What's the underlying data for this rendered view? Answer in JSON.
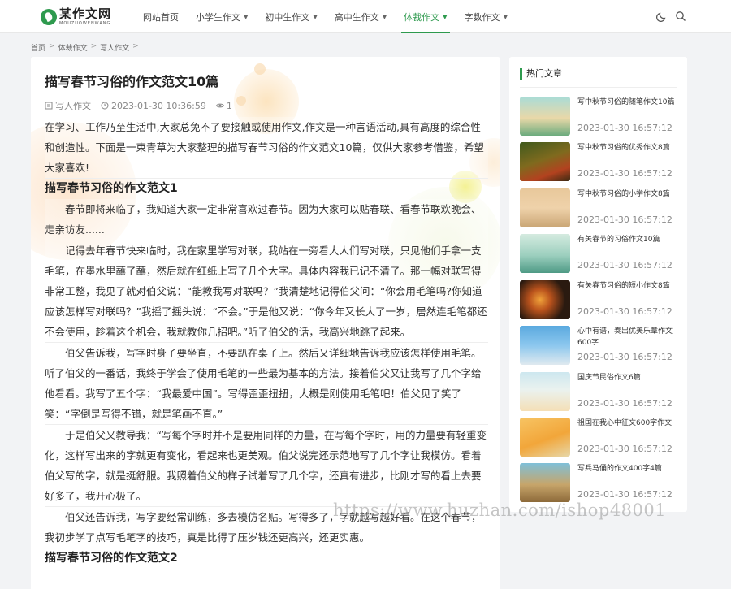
{
  "header": {
    "logo_cn": "某作文网",
    "logo_en": "MOUZUOWENWANG",
    "nav": [
      {
        "label": "网站首页",
        "caret": false
      },
      {
        "label": "小学生作文",
        "caret": true
      },
      {
        "label": "初中生作文",
        "caret": true
      },
      {
        "label": "高中生作文",
        "caret": true
      },
      {
        "label": "体裁作文",
        "caret": true,
        "active": true
      },
      {
        "label": "字数作文",
        "caret": true
      }
    ],
    "icons": [
      "moon-icon",
      "search-icon"
    ]
  },
  "breadcrumb": [
    "首页",
    "体裁作文",
    "写人作文"
  ],
  "article": {
    "title": "描写春节习俗的作文范文10篇",
    "category": "写人作文",
    "date": "2023-01-30 10:36:59",
    "views": "1",
    "intro": "在学习、工作乃至生活中,大家总免不了要接触或使用作文,作文是一种言语活动,具有高度的综合性和创造性。下面是一束青草为大家整理的描写春节习俗的作文范文10篇，仅供大家参考借鉴，希望大家喜欢!",
    "heading1": "描写春节习俗的作文范文1",
    "paragraphs": [
      "春节即将来临了，我知道大家一定非常喜欢过春节。因为大家可以贴春联、看春节联欢晚会、走亲访友......",
      "记得去年春节快来临时，我在家里学写对联，我站在一旁看大人们写对联，只见他们手拿一支毛笔，在墨水里蘸了蘸，然后就在红纸上写了几个大字。具体内容我已记不清了。那一幅对联写得非常工整，我见了就对伯父说：“能教我写对联吗？”我清楚地记得伯父问：“你会用毛笔吗?你知道应该怎样写对联吗？”我摇了摇头说：“不会。”于是他又说：“你今年又长大了一岁，居然连毛笔都还不会使用，趁着这个机会，我就教你几招吧。”听了伯父的话，我高兴地跳了起来。",
      "伯父告诉我，写字时身子要坐直，不要趴在桌子上。然后又详细地告诉我应该怎样使用毛笔。听了伯父的一番话，我终于学会了使用毛笔的一些最为基本的方法。接着伯父又让我写了几个字给他看看。我写了五个字：“我最爱中国”。写得歪歪扭扭，大概是刚使用毛笔吧！伯父见了笑了笑：“字倒是写得不错，就是笔画不直。”",
      "于是伯父又教导我：“写每个字时并不是要用同样的力量，在写每个字时，用的力量要有轻重变化，这样写出来的字就更有变化，看起来也更美观。伯父说完还示范地写了几个字让我模仿。看着伯父写的字，就是挺舒服。我照着伯父的样子试着写了几个字，还真有进步，比刚才写的看上去要好多了，我开心极了。",
      "伯父还告诉我，写字要经常训练，多去模仿名贴。写得多了，字就越写越好看。在这个春节，我初步学了点写毛笔字的技巧，真是比得了压岁钱还更高兴，还更实惠。"
    ],
    "heading2": "描写春节习俗的作文范文2"
  },
  "sidebar": {
    "title": "热门文章",
    "items": [
      {
        "title": "写中秋节习俗的随笔作文10篇",
        "date": "2023-01-30 16:57:12"
      },
      {
        "title": "写中秋节习俗的优秀作文8篇",
        "date": "2023-01-30 16:57:12"
      },
      {
        "title": "写中秋节习俗的小学作文8篇",
        "date": "2023-01-30 16:57:12"
      },
      {
        "title": "有关春节的习俗作文10篇",
        "date": "2023-01-30 16:57:12"
      },
      {
        "title": "有关春节习俗的短小作文8篇",
        "date": "2023-01-30 16:57:12"
      },
      {
        "title": "心中有谱，奏出优美乐章作文600字",
        "date": "2023-01-30 16:57:12"
      },
      {
        "title": "国庆节民俗作文6篇",
        "date": "2023-01-30 16:57:12"
      },
      {
        "title": "祖国在我心中征文600字作文",
        "date": "2023-01-30 16:57:12"
      },
      {
        "title": "写兵马俑的作文400字4篇",
        "date": "2023-01-30 16:57:12"
      }
    ]
  },
  "watermark": "https://www.huzhan.com/ishop48001",
  "colors": {
    "accent": "#2e9a4e",
    "background": "#f2f3f5"
  }
}
